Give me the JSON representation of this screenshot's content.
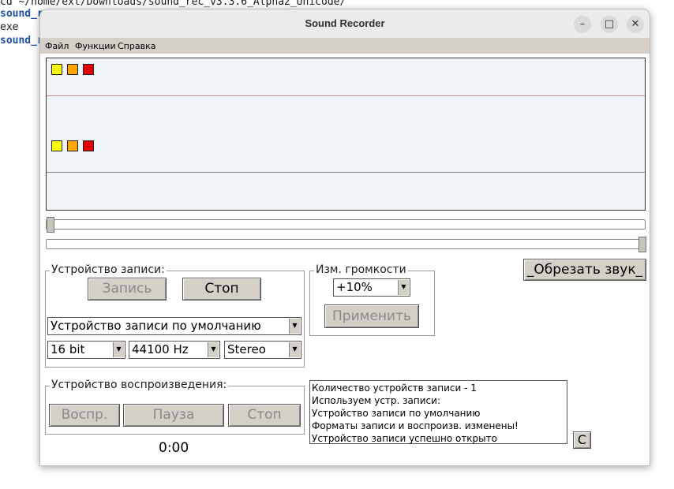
{
  "terminal": {
    "cmd": "cd ~/home/ext/Downloads/sound_rec_v3.3.6_Alpha2_Unicode/",
    "lines": [
      "sound_r",
      "exe",
      "sound_r"
    ]
  },
  "window": {
    "title": "Sound Recorder",
    "controls": {
      "minimize": "–",
      "maximize": "□",
      "close": "✕"
    }
  },
  "menu": {
    "items": [
      "Файл",
      "Функции",
      "Справка"
    ]
  },
  "waveform": {
    "channel_markers": [
      "yellow",
      "orange",
      "red"
    ],
    "colors": {
      "yellow": "#ffff00",
      "orange": "#ffa500",
      "red": "#e00000"
    }
  },
  "record_device": {
    "legend": "Устройство записи:",
    "record_label": "Запись",
    "stop_label": "Стоп",
    "device_select": "Устройство записи по умолчанию",
    "bits_select": "16 bit",
    "rate_select": "44100 Hz",
    "channels_select": "Stereo"
  },
  "volume": {
    "legend": "Изм. громкости",
    "value_select": "+10%",
    "apply_label": "Применить"
  },
  "trim_label": "_Обрезать звук_",
  "playback_device": {
    "legend": "Устройство воспроизведения:",
    "play_label": "Воспр.",
    "pause_label": "Пауза",
    "stop_label": "Стоп"
  },
  "time_display": "0:00",
  "log": {
    "lines": [
      "Количество устройств записи - 1",
      "Используем устр. записи:",
      "Устройство записи по умолчанию",
      "Форматы записи и воспроизв. изменены!",
      "Устройство записи успешно открыто"
    ],
    "clear_label": "C"
  }
}
